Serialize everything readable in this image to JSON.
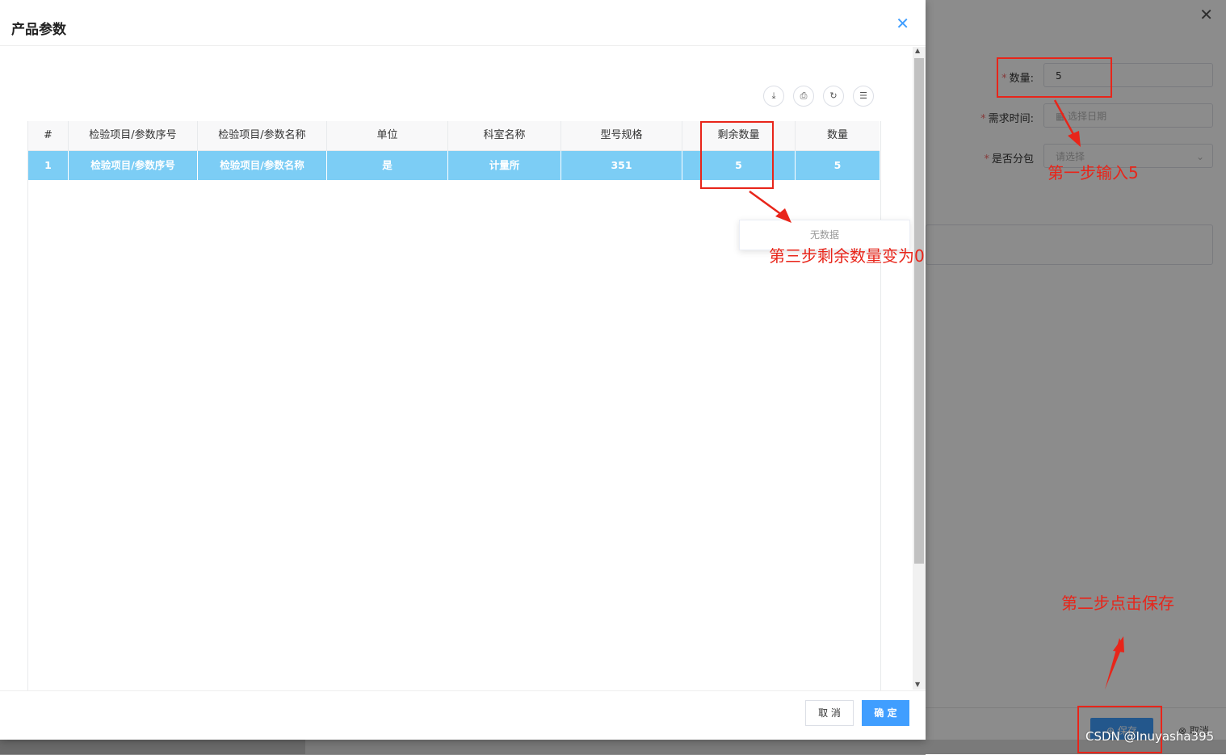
{
  "background_form": {
    "close_icon": "close-icon",
    "quantity": {
      "label": "数量:",
      "required": "*",
      "value": "5"
    },
    "demand_time": {
      "label": "需求时间:",
      "required": "*",
      "placeholder": "选择日期"
    },
    "subpackage": {
      "label": "是否分包",
      "required": "*",
      "placeholder": "请选择"
    },
    "footer": {
      "save_label": "保存",
      "cancel_label": "取消"
    }
  },
  "modal": {
    "title": "产品参数",
    "close_icon": "close-icon",
    "toolbar_icons": [
      "download-icon",
      "print-icon",
      "refresh-icon",
      "column-settings-icon"
    ],
    "table": {
      "columns": [
        "#",
        "检验项目/参数序号",
        "检验项目/参数名称",
        "单位",
        "科室名称",
        "型号规格",
        "剩余数量",
        "数量"
      ],
      "rows": [
        [
          "1",
          "检验项目/参数序号",
          "检验项目/参数名称",
          "是",
          "计量所",
          "351",
          "5",
          "5"
        ]
      ]
    },
    "empty_text": "无数据",
    "footer": {
      "cancel_label": "取 消",
      "ok_label": "确 定"
    }
  },
  "annotations": {
    "step1": "第一步输入5",
    "step2": "第二步点击保存",
    "step3": "第三步剩余数量变为0",
    "color": "#e8251a"
  },
  "watermark": "CSDN @Inuyasha395",
  "colors": {
    "primary": "#409eff",
    "selected_row": "#7ccdf5"
  }
}
